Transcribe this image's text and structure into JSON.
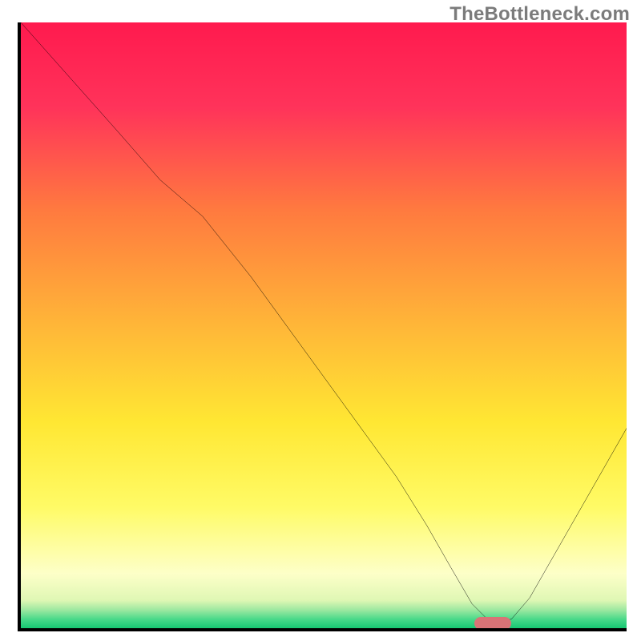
{
  "watermark": "TheBottleneck.com",
  "chart_data": {
    "type": "line",
    "title": "",
    "xlabel": "",
    "ylabel": "",
    "xlim": [
      0,
      100
    ],
    "ylim": [
      0,
      100
    ],
    "grid": false,
    "legend": false,
    "gradient_stops": [
      {
        "pos": 0.0,
        "color": "#ff1a4e"
      },
      {
        "pos": 0.14,
        "color": "#ff335a"
      },
      {
        "pos": 0.31,
        "color": "#ff7a3f"
      },
      {
        "pos": 0.5,
        "color": "#ffb638"
      },
      {
        "pos": 0.66,
        "color": "#ffe733"
      },
      {
        "pos": 0.8,
        "color": "#fffb66"
      },
      {
        "pos": 0.91,
        "color": "#fdffc8"
      },
      {
        "pos": 0.954,
        "color": "#dff7b4"
      },
      {
        "pos": 0.97,
        "color": "#9ce8a0"
      },
      {
        "pos": 0.985,
        "color": "#4ad98a"
      },
      {
        "pos": 1.0,
        "color": "#17c772"
      }
    ],
    "series": [
      {
        "name": "bottleneck-curve",
        "color": "#000000",
        "x": [
          0.0,
          8.0,
          16.0,
          23.0,
          30.0,
          38.0,
          46.0,
          54.0,
          62.0,
          67.0,
          71.0,
          74.5,
          77.0,
          79.0,
          81.0,
          84.0,
          88.0,
          92.0,
          96.0,
          100.0
        ],
        "values": [
          100.0,
          91.0,
          82.0,
          74.0,
          68.0,
          58.0,
          47.0,
          36.0,
          25.0,
          17.0,
          10.0,
          4.0,
          1.5,
          1.0,
          1.5,
          5.0,
          12.0,
          19.0,
          26.0,
          33.0
        ]
      }
    ],
    "marker": {
      "name": "optimal-point",
      "x": 77.5,
      "y": 1.3,
      "width": 6.0,
      "height": 2.2,
      "color": "#d97376"
    }
  }
}
